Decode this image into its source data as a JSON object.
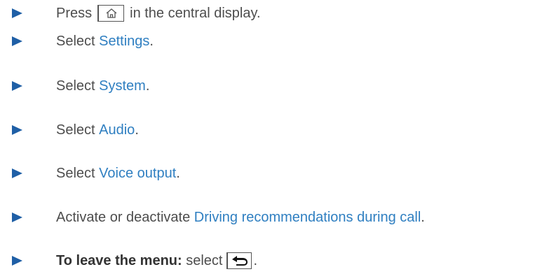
{
  "steps": [
    {
      "pre": "Press",
      "key_icon": "home-icon",
      "post": "in the central display."
    },
    {
      "pre": "Select ",
      "keyword": "Settings",
      "post": "."
    },
    {
      "pre": "Select ",
      "keyword": "System",
      "post": "."
    },
    {
      "pre": "Select ",
      "keyword": "Audio",
      "post": "."
    },
    {
      "pre": "Select ",
      "keyword": "Voice output",
      "post": "."
    },
    {
      "pre": "Activate or deactivate ",
      "keyword": "Driving recommendations during call",
      "post": "."
    },
    {
      "strong": "To leave the menu:",
      "pre": " select",
      "key_icon": "back-icon",
      "post": "."
    }
  ],
  "colors": {
    "bullet": "#1f5fa6",
    "keyword": "#2f7fc1",
    "text": "#4d4d4d"
  }
}
